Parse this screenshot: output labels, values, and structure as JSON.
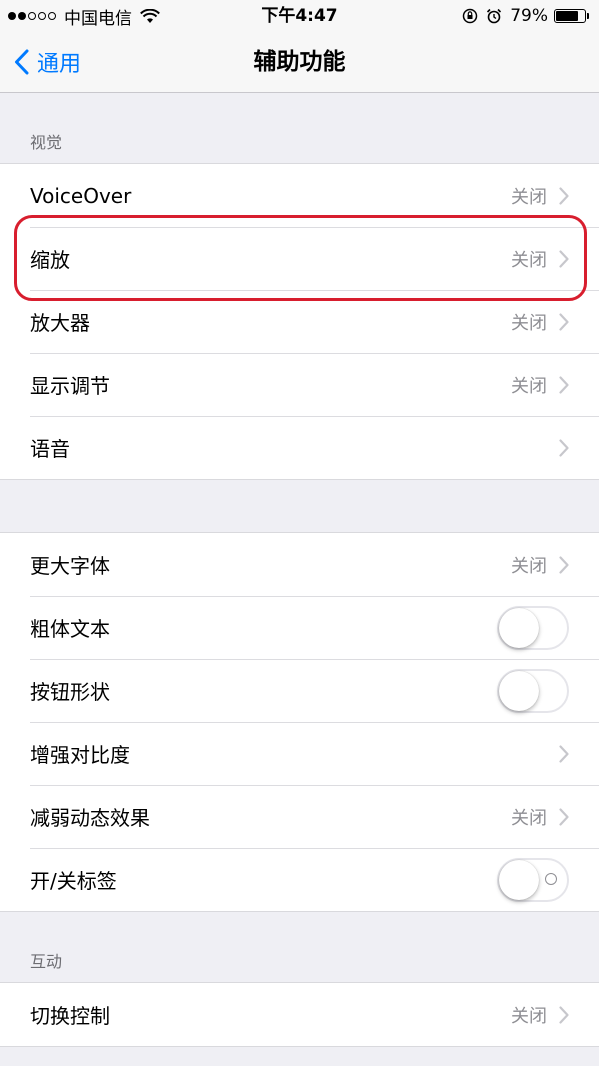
{
  "status_bar": {
    "carrier": "中国电信",
    "time": "下午4:47",
    "battery_percent": "79%",
    "battery_level": 0.79,
    "signal_bars_filled": 2,
    "signal_bars_total": 5
  },
  "nav": {
    "back_label": "通用",
    "title": "辅助功能"
  },
  "sections": {
    "vision": {
      "header": "视觉",
      "rows": [
        {
          "label": "VoiceOver",
          "value": "关闭"
        },
        {
          "label": "缩放",
          "value": "关闭"
        },
        {
          "label": "放大器",
          "value": "关闭"
        },
        {
          "label": "显示调节",
          "value": "关闭"
        },
        {
          "label": "语音",
          "value": ""
        }
      ]
    },
    "text": {
      "rows": [
        {
          "label": "更大字体",
          "value": "关闭",
          "type": "disclosure"
        },
        {
          "label": "粗体文本",
          "type": "toggle",
          "on": false
        },
        {
          "label": "按钮形状",
          "type": "toggle",
          "on": false
        },
        {
          "label": "增强对比度",
          "value": "",
          "type": "disclosure"
        },
        {
          "label": "减弱动态效果",
          "value": "关闭",
          "type": "disclosure"
        },
        {
          "label": "开/关标签",
          "type": "toggle",
          "on": false
        }
      ]
    },
    "interaction": {
      "header": "互动",
      "rows": [
        {
          "label": "切换控制",
          "value": "关闭"
        }
      ]
    }
  },
  "colors": {
    "accent": "#007aff",
    "highlight": "#d81e2e",
    "background": "#efeff4"
  }
}
